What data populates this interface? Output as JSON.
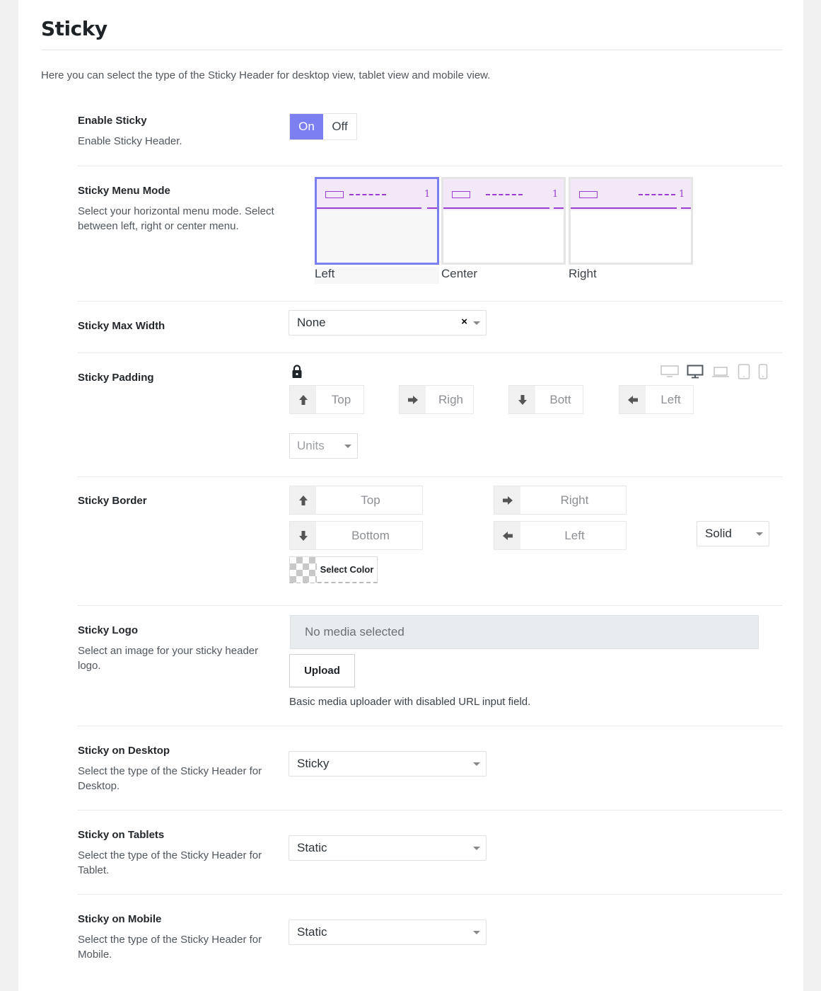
{
  "section": {
    "title": "Sticky",
    "description": "Here you can select the type of the Sticky Header for desktop view, tablet view and mobile view."
  },
  "enable_sticky": {
    "label": "Enable Sticky",
    "desc": "Enable Sticky Header.",
    "on_label": "On",
    "off_label": "Off",
    "selected": "On"
  },
  "menu_mode": {
    "label": "Sticky Menu Mode",
    "desc": "Select your horizontal menu mode. Select between left, right or center menu.",
    "options": [
      {
        "label": "Left",
        "num": "1"
      },
      {
        "label": "Center",
        "num": "1"
      },
      {
        "label": "Right",
        "num": "1"
      }
    ],
    "selected": "Left",
    "accent": "#9b3dd1"
  },
  "max_width": {
    "label": "Sticky Max Width",
    "value": "None",
    "clear_icon": "×"
  },
  "padding": {
    "label": "Sticky Padding",
    "lock_icon": "lock-icon",
    "inputs": [
      {
        "placeholder": "Top",
        "icon": "arrow-up-icon"
      },
      {
        "placeholder": "Righ",
        "icon": "arrow-right-icon"
      },
      {
        "placeholder": "Bott",
        "icon": "arrow-down-icon"
      },
      {
        "placeholder": "Left",
        "icon": "arrow-left-icon"
      }
    ],
    "units_placeholder": "Units",
    "devices": [
      "desktop-wide-icon",
      "desktop-icon",
      "laptop-icon",
      "tablet-icon",
      "mobile-icon"
    ]
  },
  "border": {
    "label": "Sticky Border",
    "inputs": [
      {
        "placeholder": "Top",
        "icon": "arrow-up-icon"
      },
      {
        "placeholder": "Right",
        "icon": "arrow-right-icon"
      },
      {
        "placeholder": "Bottom",
        "icon": "arrow-down-icon"
      },
      {
        "placeholder": "Left",
        "icon": "arrow-left-icon"
      }
    ],
    "style_value": "Solid",
    "color_label": "Select Color"
  },
  "logo": {
    "label": "Sticky Logo",
    "desc": "Select an image for your sticky header logo.",
    "media_placeholder": "No media selected",
    "upload_label": "Upload",
    "help": "Basic media uploader with disabled URL input field."
  },
  "desktop": {
    "label": "Sticky on Desktop",
    "desc": "Select the type of the Sticky Header for Desktop.",
    "value": "Sticky"
  },
  "tablets": {
    "label": "Sticky on Tablets",
    "desc": "Select the type of the Sticky Header for Tablet.",
    "value": "Static"
  },
  "mobile": {
    "label": "Sticky on Mobile",
    "desc": "Select the type of the Sticky Header for Mobile.",
    "value": "Static"
  },
  "colors": {
    "accent": "#7b7ff0",
    "menu_preview": "#9b3dd1"
  }
}
